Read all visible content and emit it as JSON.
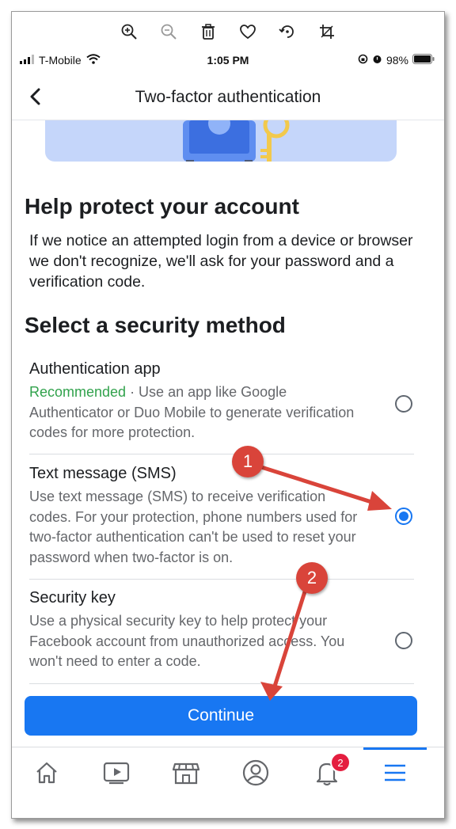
{
  "status_bar": {
    "carrier": "T-Mobile",
    "time": "1:05 PM",
    "battery": "98%"
  },
  "header": {
    "title": "Two-factor authentication"
  },
  "main": {
    "heading": "Help protect your account",
    "description": "If we notice an attempted login from a device or browser we don't recognize, we'll ask for your password and a verification code.",
    "method_heading": "Select a security method",
    "options": [
      {
        "title": "Authentication app",
        "recommended": "Recommended",
        "description": " · Use an app like Google Authenticator or Duo Mobile to generate verification codes for more protection.",
        "selected": false
      },
      {
        "title": "Text message (SMS)",
        "description": "Use text message (SMS) to receive verification codes. For your protection, phone numbers used for two-factor authentication can't be used to reset your password when two-factor is on.",
        "selected": true
      },
      {
        "title": "Security key",
        "description": "Use a physical security key to help protect your Facebook account from unauthorized access. You won't need to enter a code.",
        "selected": false
      }
    ],
    "continue_label": "Continue"
  },
  "tabbar": {
    "items": [
      "home-icon",
      "video-icon",
      "marketplace-icon",
      "profile-icon",
      "notifications-icon",
      "menu-icon"
    ],
    "notifications_badge": "2"
  },
  "annotations": {
    "step1": "1",
    "step2": "2"
  },
  "colors": {
    "accent": "#1877f2",
    "recommended": "#31a24c",
    "annotation": "#d9443a"
  }
}
